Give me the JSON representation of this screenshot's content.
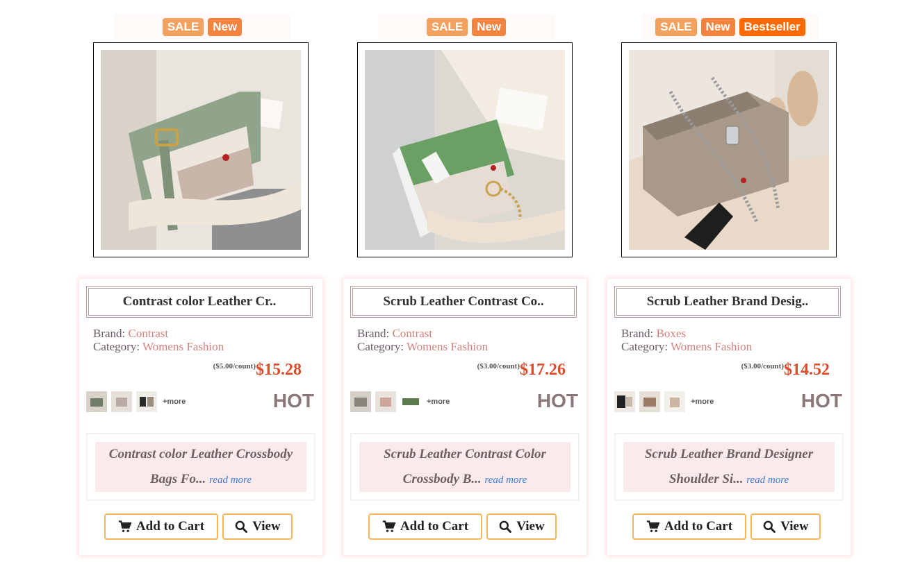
{
  "products": [
    {
      "badges": [
        "SALE",
        "New"
      ],
      "title": "Contrast color Leather Cr..",
      "brand_label": "Brand:",
      "brand": "Contrast",
      "category_label": "Category:",
      "category": "Womens Fashion",
      "unit_price": "($5.00/count)",
      "price": "$15.28",
      "more_label": "+more",
      "hot_label": "HOT",
      "description": "Contrast color Leather Crossbody Bags Fo...",
      "read_more": "read more",
      "add_to_cart": "Add to Cart",
      "view": "View"
    },
    {
      "badges": [
        "SALE",
        "New"
      ],
      "title": "Scrub Leather Contrast Co..",
      "brand_label": "Brand:",
      "brand": "Contrast",
      "category_label": "Category:",
      "category": "Womens Fashion",
      "unit_price": "($3.00/count)",
      "price": "$17.26",
      "more_label": "+more",
      "hot_label": "HOT",
      "description": "Scrub Leather Contrast Color Crossbody B...",
      "read_more": "read more",
      "add_to_cart": "Add to Cart",
      "view": "View"
    },
    {
      "badges": [
        "SALE",
        "New",
        "Bestseller"
      ],
      "title": "Scrub Leather Brand Desig..",
      "brand_label": "Brand:",
      "brand": "Boxes",
      "category_label": "Category:",
      "category": "Womens Fashion",
      "unit_price": "($3.00/count)",
      "price": "$14.52",
      "more_label": "+more",
      "hot_label": "HOT",
      "description": "Scrub Leather Brand Designer Shoulder Si...",
      "read_more": "read more",
      "add_to_cart": "Add to Cart",
      "view": "View"
    }
  ],
  "colors": {
    "sale_badge": "#f3a15f",
    "new_badge": "#f2843f",
    "bestseller_badge": "#ff6a00",
    "price": "#e04c2a",
    "brand_value": "#d5817e",
    "button_border": "#f6b557",
    "read_more": "#3c7de0"
  },
  "icons": {
    "cart": "cart-icon",
    "view": "search-icon"
  }
}
